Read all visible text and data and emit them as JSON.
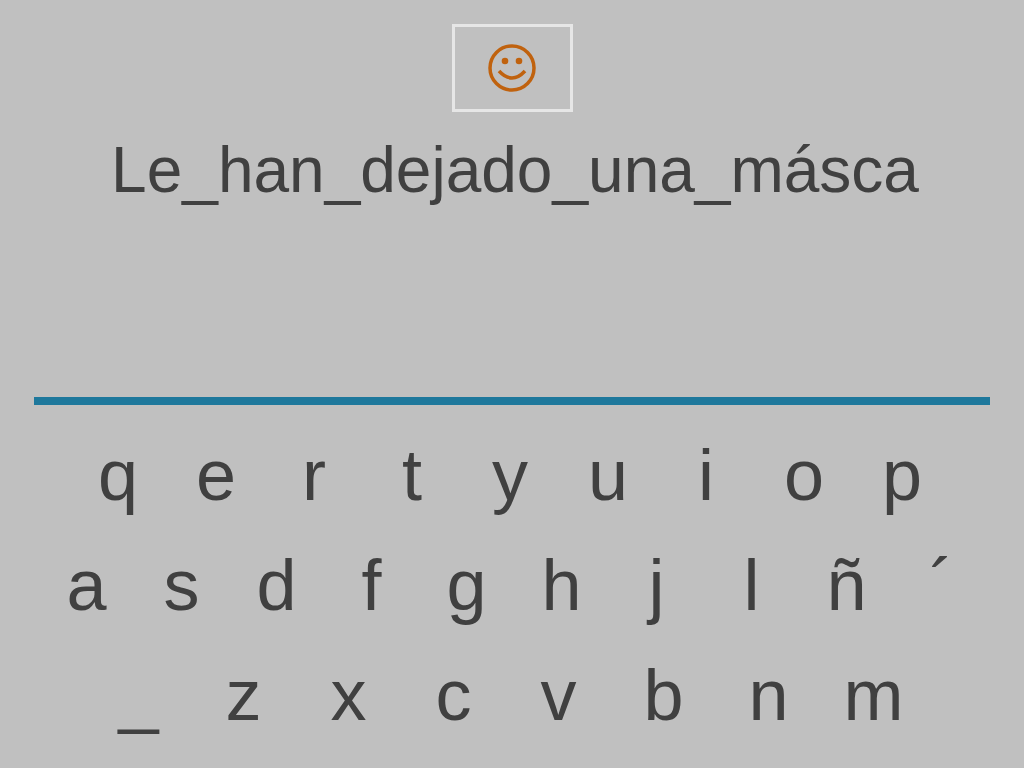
{
  "phrase": "Le_han_dejado_una_másca",
  "keyboard": [
    [
      "q",
      "e",
      "r",
      "t",
      "y",
      "u",
      "i",
      "o",
      "p"
    ],
    [
      "a",
      "s",
      "d",
      "f",
      "g",
      "h",
      "j",
      "l",
      "ñ",
      "´"
    ],
    [
      "_",
      "z",
      "x",
      "c",
      "v",
      "b",
      "n",
      "m"
    ]
  ]
}
